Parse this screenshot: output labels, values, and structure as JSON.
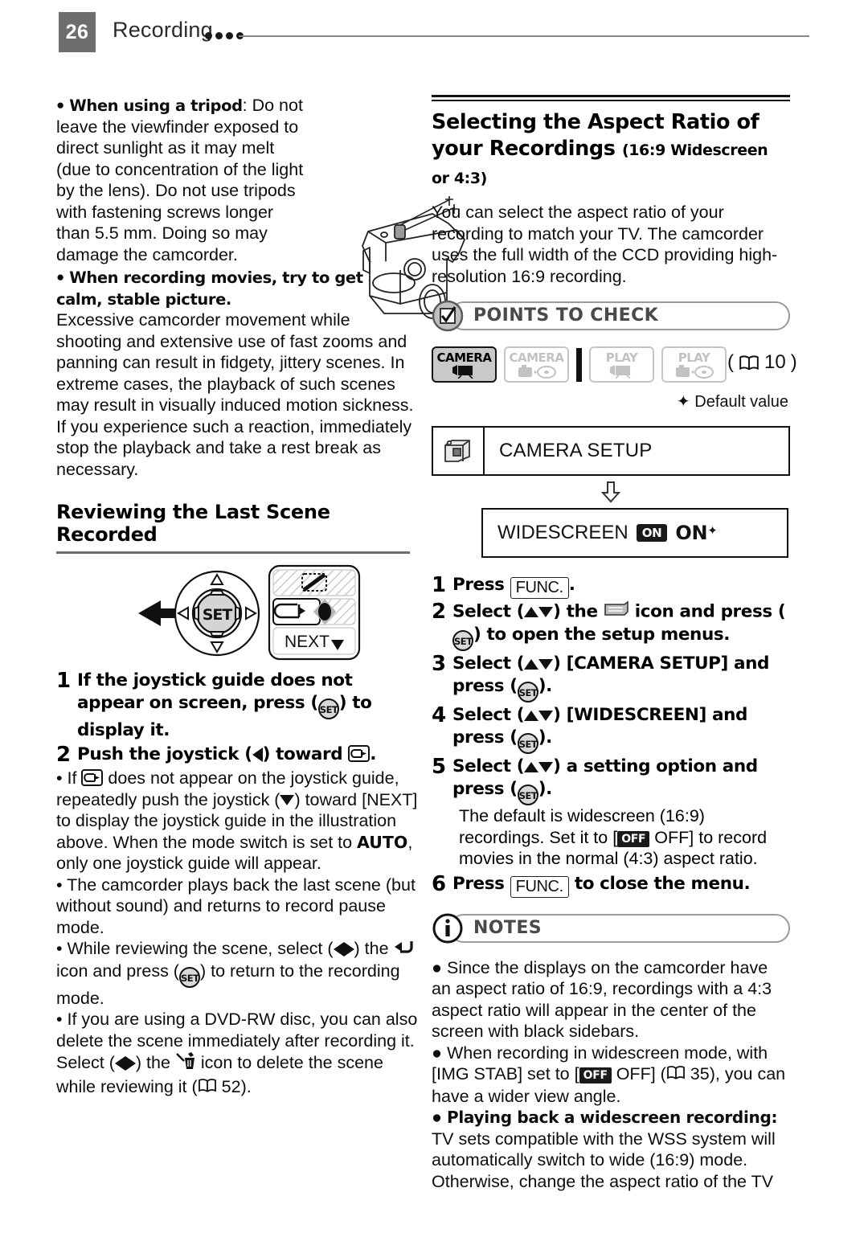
{
  "header": {
    "page_number": "26",
    "title": "Recording",
    "dot_count": 4
  },
  "left_column": {
    "tripod_note": {
      "lead": "When using a tripod",
      "lead_sep": ":",
      "text": " Do not leave the viewfinder exposed to direct sunlight as it may melt (due to concentration of the light by the lens). Do not use tripods with fastening screws longer than 5.5 mm. Doing so may damage the camcorder."
    },
    "stable_note": {
      "lead": "When recording movies, try to get a calm, stable picture.",
      "text": "Excessive camcorder movement while shooting and extensive use of fast zooms and panning can result in fidgety, jittery scenes. In extreme cases, the playback of such scenes may result in visually induced motion sickness. If you experience such a reaction, immediately stop the playback and take a rest break as necessary."
    },
    "figure": {
      "tripod_icon": "tripod-mount-illustration",
      "joystick_dial_icon": "joystick-dial-illustration",
      "joystick_guide_icon": "joystick-guide-illustration",
      "guide_next_label": "NEXT"
    },
    "subhead": "Reviewing the Last Scene Recorded",
    "steps": [
      {
        "num": "1",
        "parts_before": "If the joystick guide does not appear on screen, press (",
        "parts_after": ") to display it.",
        "button": "SET"
      },
      {
        "num": "2",
        "parts_before": "Push the joystick (",
        "parts_mid": ") toward ",
        "parts_after": "."
      }
    ],
    "step2_bullets": [
      "If  does not appear on the joystick guide, repeatedly push the joystick () toward [NEXT] to display the joystick guide in the illustration above. When the mode switch is set to AUTO, only one joystick guide will appear.",
      "The camcorder plays back the last scene (but without sound) and returns to record pause mode.",
      "While reviewing the scene, select () the  icon and press () to return to the recording mode.",
      "If you are using a DVD-RW disc, you can also delete the scene immediately after recording it. Select () the  icon to delete the scene while reviewing it ( 52)."
    ],
    "bullet_texts": {
      "b1_p1": "If ",
      "b1_p2": " does not appear on the joystick guide, repeatedly push the joystick (",
      "b1_p3": ") toward [NEXT] to display the joystick guide in the illustration above. When the mode switch is set to ",
      "b1_auto": "AUTO",
      "b1_p4": ", only one joystick guide will appear.",
      "b2": "The camcorder plays back the last scene (but without sound) and returns to record pause mode.",
      "b3_p1": "While reviewing the scene, select (",
      "b3_p2": ") the ",
      "b3_p3": " icon and press (",
      "b3_p4": ") to return to the recording mode.",
      "b4_p1": "If you are using a DVD-RW disc, you can also delete the scene immediately after recording it. Select (",
      "b4_p2": ") the ",
      "b4_p3": " icon to delete the scene while reviewing it (",
      "b4_page": "52",
      "b4_p4": ")."
    }
  },
  "right_column": {
    "section_title": "Selecting the Aspect Ratio of your Recordings",
    "section_qualifier": "(16:9 Widescreen or 4:3)",
    "intro": "You can select the aspect ratio of your recording to match your TV. The camcorder uses the full width of the CCD providing high-resolution 16:9 recording.",
    "points_to_check": {
      "label": "POINTS TO CHECK",
      "icon": "checkbox-circle-icon"
    },
    "mode_badges": [
      {
        "word": "CAMERA",
        "glyph": "movie-camera-icon",
        "state": "active"
      },
      {
        "word": "CAMERA",
        "glyph": "photo-disc-icon",
        "state": "inactive"
      },
      {
        "word": "PLAY",
        "glyph": "movie-camera-icon",
        "state": "inactive"
      },
      {
        "word": "PLAY",
        "glyph": "photo-disc-icon",
        "state": "inactive"
      }
    ],
    "page_ref": "10",
    "default_value_note": "Default value",
    "menu": {
      "setup_icon": "camcorder-icon",
      "setup_label": "CAMERA SETUP",
      "arrow_icon": "arrow-down-icon",
      "option_label": "WIDESCREEN",
      "option_badge": "ON",
      "option_value": "ON"
    },
    "steps": [
      {
        "num": "1",
        "a": "Press ",
        "btn": "FUNC.",
        "b": "."
      },
      {
        "num": "2",
        "a": "Select (",
        "b": ") the ",
        "c": " icon and press (",
        "d": ") to open the setup menus."
      },
      {
        "num": "3",
        "a": "Select (",
        "b": ") [CAMERA SETUP] and press (",
        "c": ")."
      },
      {
        "num": "4",
        "a": "Select (",
        "b": ") [WIDESCREEN] and press (",
        "c": ")."
      },
      {
        "num": "5",
        "a": "Select (",
        "b": ") a setting option and press (",
        "c": ")."
      },
      {
        "num": "6",
        "a": "Press ",
        "btn": "FUNC.",
        "b": " to close the menu."
      }
    ],
    "step5_note": {
      "p1": "The default is widescreen (16:9) recordings. Set it to [",
      "badge": "OFF",
      "p2": " OFF] to record movies in the normal (4:3) aspect ratio."
    },
    "notes": {
      "label": "NOTES",
      "icon": "info-circle-icon",
      "items": [
        {
          "type": "plain",
          "text": "Since the displays on the camcorder have an aspect ratio of 16:9, recordings with a 4:3 aspect ratio will appear in the center of the screen with black sidebars."
        },
        {
          "type": "badge",
          "p1": "When recording in widescreen mode, with [IMG STAB] set to [",
          "badge": "OFF",
          "p2": " OFF] (",
          "page": "35",
          "p3": "), you can have a wider view angle."
        },
        {
          "type": "lead",
          "lead": "Playing back a widescreen recording:",
          "text": " TV sets compatible with the WSS system will automatically switch to wide (16:9) mode. Otherwise, change the aspect ratio of the TV"
        }
      ]
    }
  },
  "colors": {
    "page_number_bg": "#6e6e6e",
    "rule_gray": "#8a8a8a",
    "badge_active_bg": "#c9c9c9",
    "badge_inactive_text": "#c2c2c2",
    "callout_text": "#4a4a4a",
    "black": "#111111"
  }
}
